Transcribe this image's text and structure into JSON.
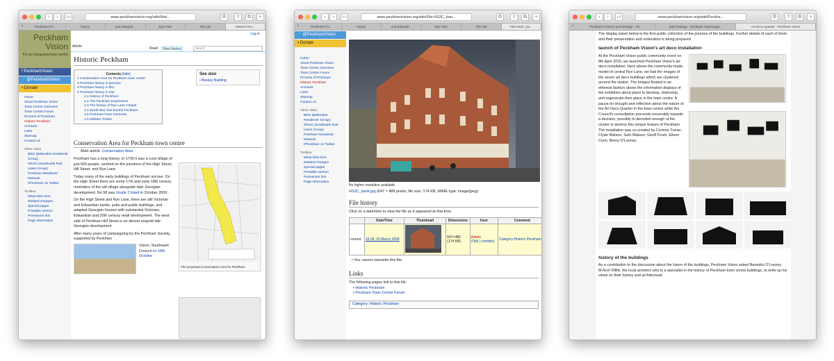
{
  "w1": {
    "url": "www.peckhamvision.org/wiki/Hist...",
    "tabs": [
      "Peckham's hi...",
      "history",
      "and Edwardi...",
      "Rye Park",
      "This site",
      "Historic Pec..."
    ],
    "login": "Log in",
    "logo": {
      "name_1": "Peckham",
      "name_2": "Vision",
      "tagline": "For an integrated town centre"
    },
    "social": {
      "facebook": "PeckhamVision",
      "twitter": "@PeckhamVision",
      "donate": "Donate"
    },
    "nav": [
      "Home",
      "About Peckham Vision",
      "Town Centre Overview",
      "Town Centre Forum",
      "Pictures of Peckham",
      "Historic Peckham",
      "Archives",
      "Links",
      "Sitemap",
      "Contact us"
    ],
    "other_sites_heading": "Other Sites",
    "other_sites": [
      "BRG (Bellenden Residents' Group)",
      "SRUG (Southwark Rail Users Group)",
      "Peckham Residents' Network",
      "#Peckham on Twitter"
    ],
    "toolbox_heading": "Toolbox",
    "toolbox": [
      "What links here",
      "Related changes",
      "Special pages",
      "Printable version",
      "Permanent link",
      "Page information"
    ],
    "article_tab": "Article",
    "read_tab": "Read",
    "view_history_tab": "View history",
    "search_placeholder": "Search",
    "title": "Historic Peckham",
    "contents": {
      "heading": "Contents",
      "hide": "[hide]",
      "items": [
        "1 Conservation Area for Peckham town centre",
        "2 Peckham history in pictures",
        "3 Peckham history in film",
        "4 Peckham history in text"
      ],
      "subitems": [
        "4.1 History of Peckham",
        "4.2 The Peckham Experiment",
        "4.3 The history of Rye Lane Chapel",
        "4.4 World War Two bombs Peckham",
        "4.5 Peckham Fram Factories",
        "4.6 Whitten Timber"
      ]
    },
    "see_also": {
      "heading": "See also",
      "link": "Bussey Building"
    },
    "section_title": "Conservation Area for Peckham town centre",
    "main_article_label": "Main article:",
    "main_article_link": "Conservation Area",
    "para1": "Peckham has a long history. In 1700 it was a rural village of just 500 people, centred on the junctions of the High Street, Hill Street, and Rye Lane.",
    "para2": "Today many of the early buildings of Peckham survive. On the High Street there are some 17th and early 18th century reminders of the old village alongside later Georgian development. No 58 was",
    "para2_link": "Grade 2 listed",
    "para2_end": "in October 2009.",
    "para3": "On the High Street and Rye Lane, there are still Victorian and Edwardian banks, pubs and public buildings, and adapted Georgian houses with substantial Victorian, Edwardian and 20th century retail development. The west side of Peckham Hill Street is an almost unspoilt late Georgian development.",
    "para4": "After many years of campaigning by the Peckham Society, supported by Peckham",
    "para4b": "Vision, Southwark Council",
    "para4_link": "on 18th October",
    "map_caption": "The proposed Conservation Area for Peckham."
  },
  "w2": {
    "url": "www.peckhamvision.org/wiki/File:HS3C_ban...",
    "tabs": [
      "Peckham's hi...",
      "history",
      "and Edwardi...",
      "Rye Park",
      "This site",
      "File:HS3C_ba..."
    ],
    "social": {
      "twitter": "@PeckhamVision",
      "donate": "Donate"
    },
    "nav": [
      "Home",
      "About Peckham Vision",
      "Town Centre Overview",
      "Town Centre Forum",
      "Pictures of Peckham",
      "Historic Peckham",
      "Archives",
      "Links",
      "Sitemap",
      "Contact us"
    ],
    "other_sites_heading": "Other Sites",
    "other_sites": [
      "BRG (Bellenden Residents' Group)",
      "SRUG (Southwark Rail Users Group)",
      "Peckham Residents' Network",
      "#Peckham on Twitter"
    ],
    "toolbox_heading": "Toolbox",
    "toolbox": [
      "What links here",
      "Related changes",
      "Special pages",
      "Printable version",
      "Permanent link",
      "Page information"
    ],
    "no_higher": "No higher resolution available.",
    "file_name": "HS3C_bank.jpg",
    "file_info": "(647 × 486 pixels, file size: 174 KB, MIME type: image/jpeg)",
    "file_history_title": "File history",
    "file_history_text": "Click on a date/time to view the file as it appeared at that time.",
    "table_headers": [
      "Date/Time",
      "Thumbnail",
      "Dimensions",
      "User",
      "Comment"
    ],
    "row_status": "current",
    "row_date": "16:34, 20 March 2008",
    "row_dim1": "647×486",
    "row_dim2": "(174 KB)",
    "row_user": "Admin",
    "row_talk": "(Talk | contribs)",
    "row_comment": "Category:Historic Peckham",
    "no_overwrite": "You cannot overwrite this file.",
    "links_title": "Links",
    "links_text": "The following pages link to this file:",
    "links": [
      "Historic Peckham",
      "Peckham Town Centre Forum"
    ],
    "category_label": "Category:",
    "category_link": "Historic Peckham"
  },
  "w3": {
    "url": "www.peckhamvision.org/wiki/Peckha...",
    "tabs": [
      "Peckham's history and heritage - Pe...",
      "Built heritage - Peckham Townscape...",
      "Art Deco Quarter - Peckham Vision"
    ],
    "intro": "The display panel below is the first public collection of the pictures of the buildings. Further details of each of them and their preservation and restoration is being prepared",
    "h_launch": "launch of Peckham Vision's art deco installation",
    "launch_text": "At the Peckham Vision public community event on 8th April 2015, we launched Peckham Vision's art deco installation. Here above the community-made model of central Rye Lane, we had the images of the seven art deco buildings which are clustered around the station. The images floated in an ethereal fashion above the information displays of the exhibition about plans to develop, redevelop, and regenerate their place in the town centre. A pause for thought and reflection about the nature of the Art Deco Quarter in the town centre while the Council's consultation proceeds inexorably towards a decision, possibly to demolish enough of the cluster to destroy this unique feature of Peckham. The installation was co-created by Corinne Turner, Clyde Watson, Sam Watson, Geoff Frosh, Eileen Conn, Benry O'Looney.",
    "h_history": "history of the buildings",
    "history_text": "As a contribution to the discussion about the future of the buildings, Peckham Vision asked Benedict O'Looney M.Arch RIBA, the local architect who is a specialist in the history of Peckham town centre buildings, to write up his views on their history and architectural"
  }
}
